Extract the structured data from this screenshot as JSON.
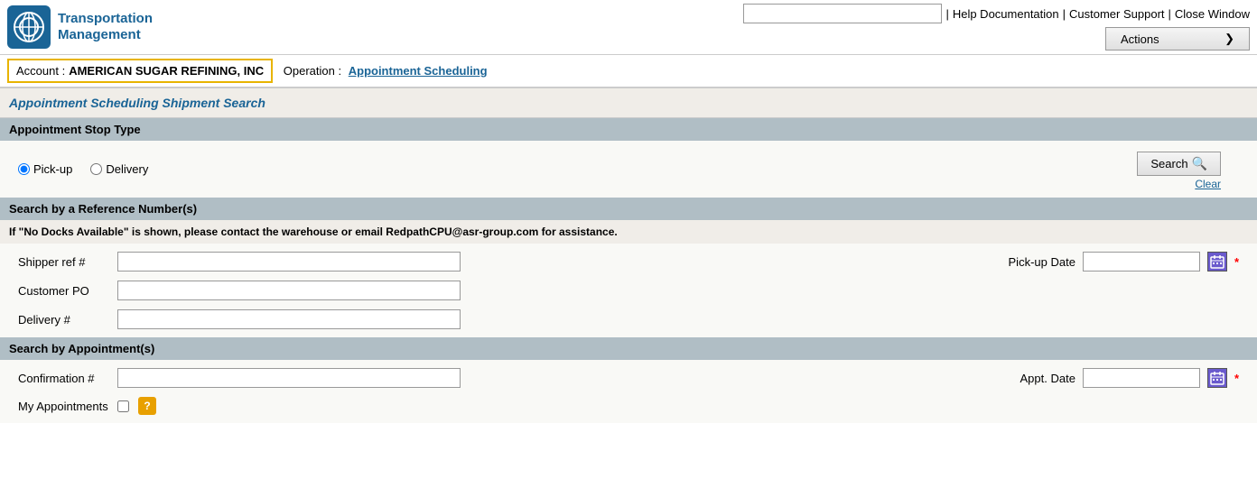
{
  "app": {
    "logo_line1": "Transportation",
    "logo_line2": "Management"
  },
  "header": {
    "search_placeholder": "",
    "help_label": "Help Documentation",
    "support_label": "Customer Support",
    "close_label": "Close Window",
    "actions_label": "Actions"
  },
  "account": {
    "label": "Account :",
    "name": "AMERICAN SUGAR REFINING, INC",
    "operation_label": "Operation :",
    "operation_link": "Appointment Scheduling"
  },
  "page": {
    "title": "Appointment Scheduling Shipment Search",
    "stop_type_header": "Appointment Stop Type",
    "pickup_label": "Pick-up",
    "delivery_label": "Delivery",
    "search_btn": "Search",
    "clear_btn": "Clear",
    "ref_section": "Search by a Reference Number(s)",
    "info_message": "If \"No Docks Available\" is shown, please contact the warehouse or email RedpathCPU@asr-group.com for assistance.",
    "shipper_ref_label": "Shipper ref #",
    "customer_po_label": "Customer PO",
    "delivery_label2": "Delivery #",
    "pickup_date_label": "Pick-up Date",
    "required_star": "*",
    "appt_section": "Search by Appointment(s)",
    "confirmation_label": "Confirmation #",
    "appt_date_label": "Appt. Date",
    "my_appointments_label": "My Appointments"
  },
  "form": {
    "shipper_ref_value": "",
    "customer_po_value": "",
    "delivery_value": "",
    "pickup_date_value": "",
    "confirmation_value": "",
    "appt_date_value": ""
  }
}
